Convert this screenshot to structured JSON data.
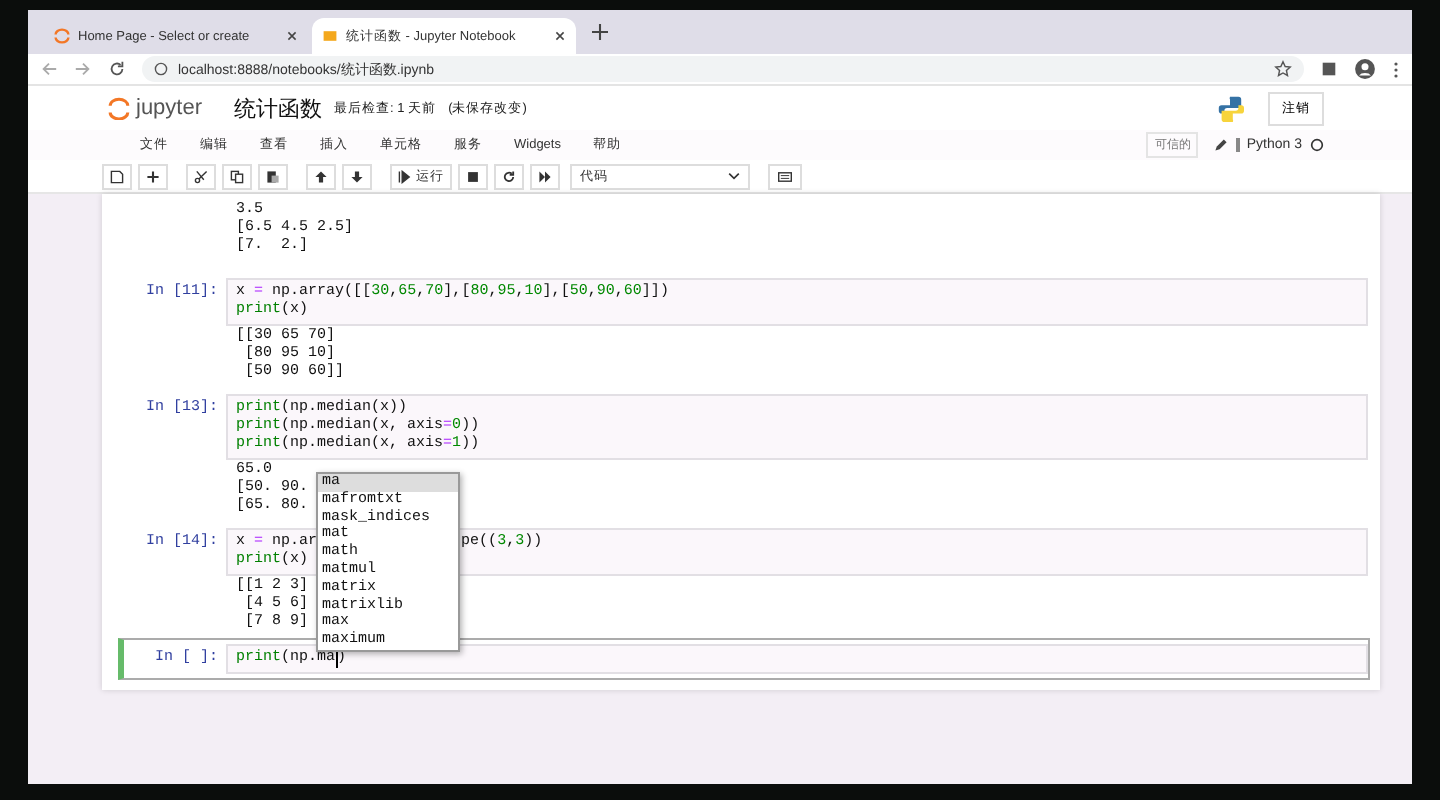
{
  "browser": {
    "tabs": [
      {
        "title": "Home Page - Select or create",
        "selected": false
      },
      {
        "title": "统计函数 - Jupyter Notebook",
        "selected": true
      }
    ],
    "address": "localhost:8888/notebooks/统计函数.ipynb"
  },
  "header": {
    "logo_text": "jupyter",
    "title": "统计函数",
    "checkpoint": "最后检查: 1 天前",
    "unsaved": "(未保存改变)",
    "logout": "注销"
  },
  "menu": [
    "文件",
    "编辑",
    "查看",
    "插入",
    "单元格",
    "服务",
    "Widgets",
    "帮助"
  ],
  "status": {
    "trusted": "可信的",
    "kernel": "Python 3"
  },
  "toolbar": {
    "run_label": "运行",
    "cell_type": "代码"
  },
  "cells": [
    {
      "kind": "output",
      "output": [
        "3.5",
        "[6.5 4.5 2.5]",
        "[7.  2.]"
      ]
    },
    {
      "kind": "code",
      "prompt": "In [11]:",
      "selected": false,
      "code": [
        [
          "x = np.array([[30,65,70],[80,95,10],[50,90,60]])"
        ],
        [
          "print(x)"
        ]
      ],
      "output": [
        "[[30 65 70]",
        " [80 95 10]",
        " [50 90 60]]"
      ]
    },
    {
      "kind": "code",
      "prompt": "In [13]:",
      "selected": false,
      "code": [
        [
          "print(np.median(x))"
        ],
        [
          "print(np.median(x, axis=0))"
        ],
        [
          "print(np.median(x, axis=1))"
        ]
      ],
      "output": [
        "65.0",
        "[50. 90.",
        "[65. 80."
      ]
    },
    {
      "kind": "code",
      "prompt": "In [14]:",
      "selected": false,
      "code": [
        [
          "x = np.ar",
          "pe((3,3))"
        ],
        [
          "print(x)"
        ]
      ],
      "output": [
        "[[1 2 3]",
        " [4 5 6]",
        " [7 8 9]"
      ]
    },
    {
      "kind": "code",
      "prompt": "In [ ]:",
      "selected": true,
      "code": [
        [
          "print(np.ma",
          ")"
        ]
      ]
    }
  ],
  "completion": [
    {
      "label": "ma",
      "selected": true
    },
    {
      "label": "mafromtxt",
      "selected": false
    },
    {
      "label": "mask_indices",
      "selected": false
    },
    {
      "label": "mat",
      "selected": false
    },
    {
      "label": "math",
      "selected": false
    },
    {
      "label": "matmul",
      "selected": false
    },
    {
      "label": "matrix",
      "selected": false
    },
    {
      "label": "matrixlib",
      "selected": false
    },
    {
      "label": "max",
      "selected": false
    },
    {
      "label": "maximum",
      "selected": false
    }
  ]
}
